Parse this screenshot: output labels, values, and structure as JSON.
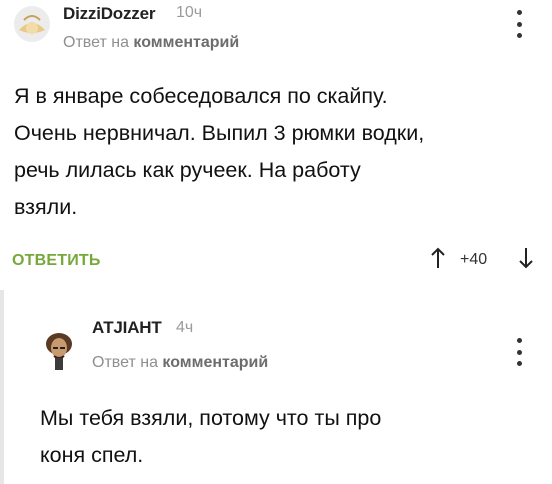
{
  "comment1": {
    "author": "DizziDozzer",
    "time": "10ч",
    "reply_prefix": "Ответ на",
    "reply_target": "комментарий",
    "text_lines": [
      "Я в январе собеседовался по скайпу.",
      "Очень нервничал. Выпил 3 рюмки водки,",
      "речь лилась как ручеек. На работу",
      "взяли."
    ],
    "reply_label": "ОТВЕТИТЬ",
    "votes": "+40"
  },
  "comment2": {
    "author": "АТЈІАНТ",
    "time": "4ч",
    "reply_prefix": "Ответ на",
    "reply_target": "комментарий",
    "text_lines": [
      "Мы тебя взяли, потому что ты про",
      "коня спел."
    ]
  },
  "icons": {
    "upvote": "arrow-up",
    "downvote": "arrow-down",
    "more": "vertical-dots"
  },
  "colors": {
    "reply_button": "#76a83a",
    "meta_text": "#8f8f8f"
  }
}
